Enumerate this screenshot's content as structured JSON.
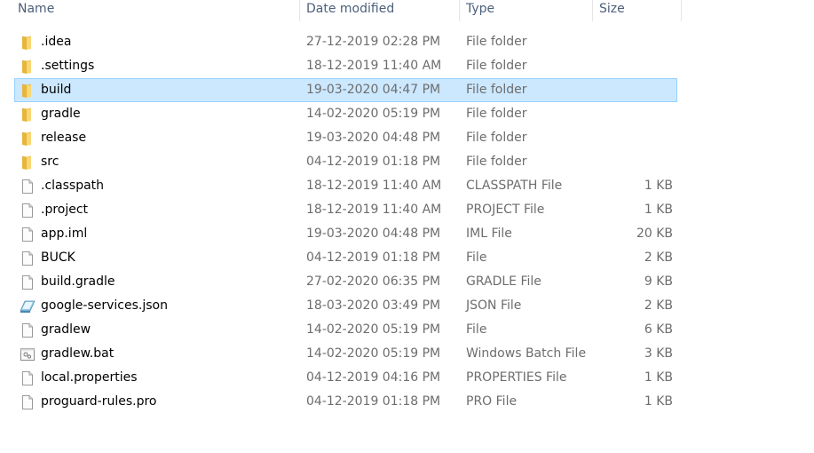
{
  "columns": {
    "name": "Name",
    "date": "Date modified",
    "type": "Type",
    "size": "Size"
  },
  "colors": {
    "selection_bg": "#cce8ff",
    "selection_border": "#99d1ff",
    "folder": "#f5c84c"
  },
  "files": [
    {
      "name": ".idea",
      "date": "27-12-2019 02:28 PM",
      "type": "File folder",
      "size": "",
      "icon": "folder-icon",
      "selected": false
    },
    {
      "name": ".settings",
      "date": "18-12-2019 11:40 AM",
      "type": "File folder",
      "size": "",
      "icon": "folder-icon",
      "selected": false
    },
    {
      "name": "build",
      "date": "19-03-2020 04:47 PM",
      "type": "File folder",
      "size": "",
      "icon": "folder-icon",
      "selected": true
    },
    {
      "name": "gradle",
      "date": "14-02-2020 05:19 PM",
      "type": "File folder",
      "size": "",
      "icon": "folder-icon",
      "selected": false
    },
    {
      "name": "release",
      "date": "19-03-2020 04:48 PM",
      "type": "File folder",
      "size": "",
      "icon": "folder-icon",
      "selected": false
    },
    {
      "name": "src",
      "date": "04-12-2019 01:18 PM",
      "type": "File folder",
      "size": "",
      "icon": "folder-icon",
      "selected": false
    },
    {
      "name": ".classpath",
      "date": "18-12-2019 11:40 AM",
      "type": "CLASSPATH File",
      "size": "1 KB",
      "icon": "file-icon",
      "selected": false
    },
    {
      "name": ".project",
      "date": "18-12-2019 11:40 AM",
      "type": "PROJECT File",
      "size": "1 KB",
      "icon": "file-icon",
      "selected": false
    },
    {
      "name": "app.iml",
      "date": "19-03-2020 04:48 PM",
      "type": "IML File",
      "size": "20 KB",
      "icon": "file-icon",
      "selected": false
    },
    {
      "name": "BUCK",
      "date": "04-12-2019 01:18 PM",
      "type": "File",
      "size": "2 KB",
      "icon": "file-icon",
      "selected": false
    },
    {
      "name": "build.gradle",
      "date": "27-02-2020 06:35 PM",
      "type": "GRADLE File",
      "size": "9 KB",
      "icon": "file-icon",
      "selected": false
    },
    {
      "name": "google-services.json",
      "date": "18-03-2020 03:49 PM",
      "type": "JSON File",
      "size": "2 KB",
      "icon": "notepad-icon",
      "selected": false
    },
    {
      "name": "gradlew",
      "date": "14-02-2020 05:19 PM",
      "type": "File",
      "size": "6 KB",
      "icon": "file-icon",
      "selected": false
    },
    {
      "name": "gradlew.bat",
      "date": "14-02-2020 05:19 PM",
      "type": "Windows Batch File",
      "size": "3 KB",
      "icon": "batch-file-icon",
      "selected": false
    },
    {
      "name": "local.properties",
      "date": "04-12-2019 04:16 PM",
      "type": "PROPERTIES File",
      "size": "1 KB",
      "icon": "file-icon",
      "selected": false
    },
    {
      "name": "proguard-rules.pro",
      "date": "04-12-2019 01:18 PM",
      "type": "PRO File",
      "size": "1 KB",
      "icon": "file-icon",
      "selected": false
    }
  ]
}
